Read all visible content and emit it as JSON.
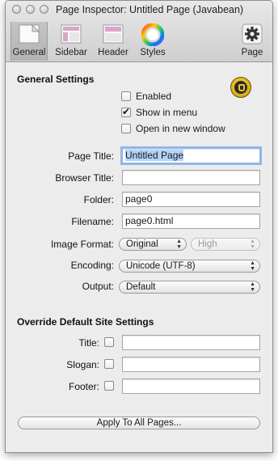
{
  "window": {
    "title": "Page Inspector: Untitled Page (Javabean)"
  },
  "toolbar": {
    "general": "General",
    "sidebar": "Sidebar",
    "header": "Header",
    "styles": "Styles",
    "page": "Page"
  },
  "general": {
    "heading": "General Settings",
    "enabled": {
      "label": "Enabled",
      "checked": false
    },
    "show_in_menu": {
      "label": "Show in menu",
      "checked": true
    },
    "open_new_window": {
      "label": "Open in new window",
      "checked": false
    },
    "page_title": {
      "label": "Page Title:",
      "value": "Untitled Page"
    },
    "browser_title": {
      "label": "Browser Title:",
      "value": ""
    },
    "folder": {
      "label": "Folder:",
      "value": "page0"
    },
    "filename": {
      "label": "Filename:",
      "value": "page0.html"
    },
    "image_format": {
      "label": "Image Format:",
      "value": "Original",
      "quality": "High"
    },
    "encoding": {
      "label": "Encoding:",
      "value": "Unicode (UTF-8)"
    },
    "output": {
      "label": "Output:",
      "value": "Default"
    }
  },
  "override": {
    "heading": "Override Default Site Settings",
    "title": {
      "label": "Title:",
      "value": ""
    },
    "slogan": {
      "label": "Slogan:",
      "value": ""
    },
    "footer": {
      "label": "Footer:",
      "value": ""
    }
  },
  "apply_button": "Apply To All Pages..."
}
